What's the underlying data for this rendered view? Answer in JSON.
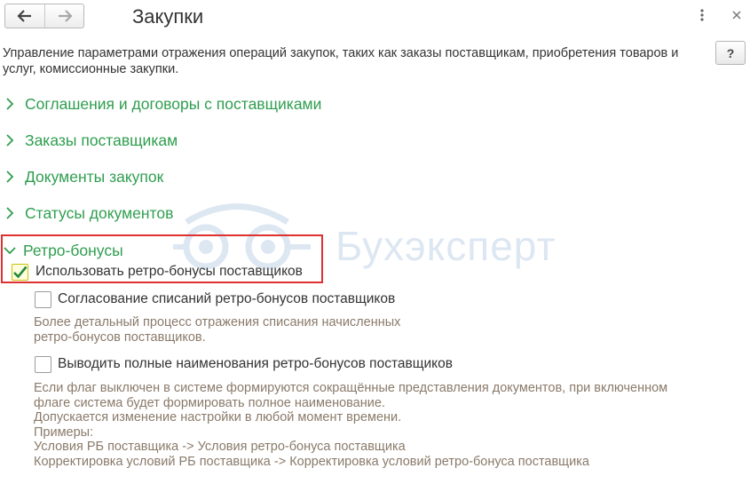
{
  "window": {
    "title": "Закупки",
    "back_icon": "arrow-left-icon",
    "forward_icon": "arrow-right-icon",
    "more_icon": "more-vertical-icon",
    "close_icon": "close-icon"
  },
  "help": {
    "label": "?"
  },
  "description": "Управление параметрами отражения операций закупок, таких как заказы поставщикам, приобретения товаров и услуг, комиссионные закупки.",
  "sections": [
    {
      "label": "Соглашения и договоры с поставщиками",
      "expanded": false
    },
    {
      "label": "Заказы поставщикам",
      "expanded": false
    },
    {
      "label": "Документы закупок",
      "expanded": false
    },
    {
      "label": "Статусы документов",
      "expanded": false
    },
    {
      "label": "Ретро-бонусы",
      "expanded": true
    }
  ],
  "retro": {
    "use_checkbox": {
      "label": "Использовать ретро-бонусы поставщиков",
      "checked": true
    },
    "approval_checkbox": {
      "label": "Согласование списаний ретро-бонусов поставщиков",
      "checked": false
    },
    "approval_hint": [
      "Более детальный процесс отражения списания начисленных",
      "ретро-бонусов поставщиков."
    ],
    "fullnames_checkbox": {
      "label": "Выводить полные наименования ретро-бонусов поставщиков",
      "checked": false
    },
    "fullnames_hint": [
      "Если флаг выключен в системе формируются сокращённые представления документов, при включенном",
      "флаге система будет формировать полное наименование.",
      "Допускается изменение настройки в любой момент времени.",
      "Примеры:",
      "Условия РБ поставщика -> Условия ретро-бонуса поставщика",
      "Корректировка условий РБ поставщика -> Корректировка условий ретро-бонуса поставщика"
    ]
  },
  "watermark": {
    "text": "Бухэксперт"
  },
  "colors": {
    "section_green": "#2f9e4f",
    "highlight_red": "#e03131",
    "hint_text": "#8a7a6a",
    "checkbox_checked_border": "#c9c300"
  }
}
